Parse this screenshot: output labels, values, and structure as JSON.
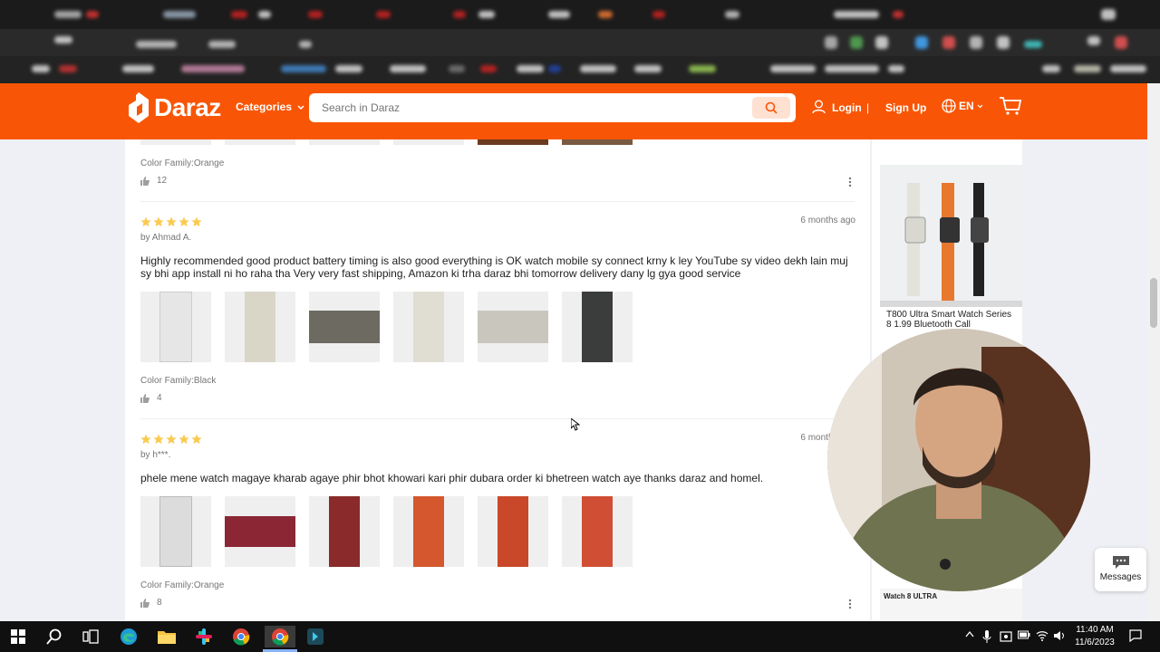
{
  "header": {
    "brand": "Daraz",
    "categories_label": "Categories",
    "search_placeholder": "Search in Daraz",
    "login_label": "Login",
    "separator": "|",
    "signup_label": "Sign Up",
    "language": "EN",
    "brand_color": "#f85606"
  },
  "reviews": [
    {
      "color_family": "Color Family:Orange",
      "likes": "12"
    },
    {
      "rating": 5,
      "author": "by Ahmad A.",
      "date": "6 months ago",
      "text": "Highly recommended good product battery timing is also good everything is OK watch mobile sy connect krny k ley YouTube sy video dekh lain muj sy bhi app install ni ho raha tha Very very fast shipping, Amazon ki trha daraz bhi tomorrow delivery dany lg gya good service",
      "photo_count": 6,
      "color_family": "Color Family:Black",
      "likes": "4"
    },
    {
      "rating": 5,
      "author": "by h***.",
      "date": "6 months ago",
      "text": "phele mene watch magaye kharab agaye phir bhot khowari kari phir dubara order ki bhetreen watch aye thanks daraz and homel.",
      "photo_count": 6,
      "color_family": "Color Family:Orange",
      "likes": "8"
    }
  ],
  "sidebar": {
    "product_title": "T800 Ultra Smart Watch Series 8 1.99 Bluetooth Call",
    "next_product_label": "Watch 8 ULTRA"
  },
  "messages_label": "Messages",
  "taskbar": {
    "time": "11:40 AM",
    "date": "11/6/2023"
  },
  "colors": {
    "star": "#faca51",
    "page_bg": "#eff0f5"
  }
}
